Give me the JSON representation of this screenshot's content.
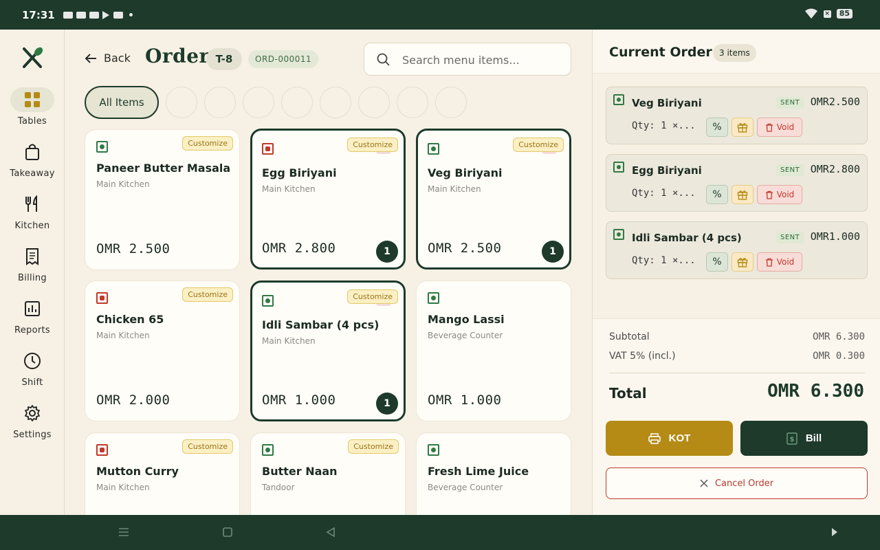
{
  "status_bar": {
    "time": "17:31",
    "battery": "85",
    "icons": [
      "notification-icon",
      "notification-icon",
      "notification-icon",
      "play-store-icon",
      "cast-icon",
      "wifi-icon",
      "no-sim-icon",
      "battery-icon"
    ]
  },
  "sidebar": {
    "logo_icon": "crossed-utensils-icon",
    "items": [
      {
        "label": "Tables",
        "icon": "grid-icon",
        "active": true
      },
      {
        "label": "Takeaway",
        "icon": "bag-icon",
        "active": false
      },
      {
        "label": "Kitchen",
        "icon": "fork-knife-icon",
        "active": false
      },
      {
        "label": "Billing",
        "icon": "receipt-icon",
        "active": false
      },
      {
        "label": "Reports",
        "icon": "bar-chart-icon",
        "active": false
      },
      {
        "label": "Shift",
        "icon": "clock-icon",
        "active": false
      },
      {
        "label": "Settings",
        "icon": "gear-icon",
        "active": false
      }
    ]
  },
  "header": {
    "back_label": "Back",
    "title": "Order",
    "table": "T-8",
    "order_id": "ORD-000011",
    "search_placeholder": "Search menu items..."
  },
  "categories": {
    "selected": "All Items",
    "empty_count": 8
  },
  "menu_items": [
    {
      "name": "Paneer Butter Masala",
      "kitchen": "Main Kitchen",
      "price": "OMR 2.500",
      "veg": true,
      "customize": "Customize",
      "qty": null
    },
    {
      "name": "Egg Biriyani",
      "kitchen": "Main Kitchen",
      "price": "OMR 2.800",
      "veg": false,
      "customize": "Customize",
      "qty": "1"
    },
    {
      "name": "Veg Biriyani",
      "kitchen": "Main Kitchen",
      "price": "OMR 2.500",
      "veg": true,
      "customize": "Customize",
      "qty": "1"
    },
    {
      "name": "Chicken 65",
      "kitchen": "Main Kitchen",
      "price": "OMR 2.000",
      "veg": false,
      "customize": "Customize",
      "qty": null
    },
    {
      "name": "Idli Sambar (4 pcs)",
      "kitchen": "Main Kitchen",
      "price": "OMR 1.000",
      "veg": true,
      "customize": "Customize",
      "qty": "1"
    },
    {
      "name": "Mango Lassi",
      "kitchen": "Beverage Counter",
      "price": "OMR 1.000",
      "veg": true,
      "customize": null,
      "qty": null
    },
    {
      "name": "Mutton Curry",
      "kitchen": "Main Kitchen",
      "price": "",
      "veg": false,
      "customize": "Customize",
      "qty": null
    },
    {
      "name": "Butter Naan",
      "kitchen": "Tandoor",
      "price": "",
      "veg": true,
      "customize": "Customize",
      "qty": null
    },
    {
      "name": "Fresh Lime Juice",
      "kitchen": "Beverage Counter",
      "price": "",
      "veg": true,
      "customize": null,
      "qty": null
    }
  ],
  "current_order": {
    "title": "Current Order",
    "count": "3 items",
    "lines": [
      {
        "name": "Veg Biriyani",
        "status": "SENT",
        "price": "OMR2.500",
        "qty": "Qty: 1 ×...",
        "discount": "%",
        "void": "Void"
      },
      {
        "name": "Egg Biriyani",
        "status": "SENT",
        "price": "OMR2.800",
        "qty": "Qty: 1 ×...",
        "discount": "%",
        "void": "Void"
      },
      {
        "name": "Idli Sambar (4 pcs)",
        "status": "SENT",
        "price": "OMR1.000",
        "qty": "Qty: 1 ×...",
        "discount": "%",
        "void": "Void"
      }
    ],
    "subtotal_label": "Subtotal",
    "subtotal": "OMR 6.300",
    "vat_label": "VAT 5% (incl.)",
    "vat": "OMR 0.300",
    "total_label": "Total",
    "total": "OMR 6.300",
    "kot_label": "KOT",
    "bill_label": "Bill",
    "cancel_label": "Cancel Order"
  },
  "colors": {
    "primary": "#1d3a2b",
    "accent": "#b58b16",
    "danger": "#c0392b",
    "background": "#f6f1e4"
  }
}
